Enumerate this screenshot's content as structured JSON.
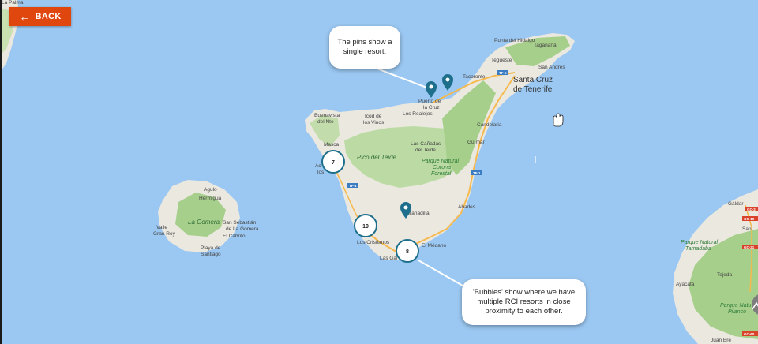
{
  "nav": {
    "back_label": "BACK",
    "back_icon": "arrow-left-icon"
  },
  "callouts": {
    "pins": "The pins show a single resort.",
    "bubbles": "'Bubbles' show where we have multiple RCI resorts in close proximity to each other."
  },
  "clusters": [
    {
      "id": "cluster-west",
      "count": "7"
    },
    {
      "id": "cluster-south",
      "count": "19"
    },
    {
      "id": "cluster-lasgalletas",
      "count": "8"
    }
  ],
  "pins": [
    {
      "id": "pin-puerto-1"
    },
    {
      "id": "pin-puerto-2"
    },
    {
      "id": "pin-granadilla"
    }
  ],
  "places": {
    "la_palma": "La Palma",
    "punta_del_hidalgo": "Punta del Hidalgo",
    "taganana": "Taganana",
    "tegueste": "Tegueste",
    "san_andres": "San Andrés",
    "tacoronte": "Tacoronte",
    "santa_cruz_1": "Santa Cruz",
    "santa_cruz_2": "de Tenerife",
    "puerto_1": "Puerto de",
    "puerto_2": "la Cruz",
    "los_realejos": "Los Realejos",
    "buenavista_1": "Buenavista",
    "buenavista_2": "del Nte",
    "icod_1": "Icod de",
    "icod_2": "los Vinos",
    "candelaria": "Candelaria",
    "masca": "Masca",
    "las_canadas_1": "Las Cañadas",
    "las_canadas_2": "del Teide",
    "guimar": "Güímar",
    "pico_del_teide": "Pico del Teide",
    "parque_1": "Parque Natural",
    "parque_2": "Corona",
    "parque_3": "Forestal",
    "acantilado_1": "Ac",
    "acantilado_2": "los",
    "agulo": "Agulo",
    "hermigua": "Hermigua",
    "la_gomera": "La Gomera",
    "san_sebastian_1": "San Sebastián",
    "san_sebastian_2": "de La Gomera",
    "valle_1": "Valle",
    "valle_2": "Gran Rey",
    "el_cabrito": "El Cabrito",
    "playa_1": "Playa de",
    "playa_2": "Santiago",
    "granadilla": "Granadilla",
    "abades": "Abades",
    "los_cristianos": "Los Cristianos",
    "el_medano": "El Médano",
    "las_galletas": "Las Gal",
    "cristianos_short": "C",
    "galdar": "Gáldar",
    "gc_parque_1": "Parque Natural",
    "gc_parque_2": "Tamadaba",
    "gc_parque_3": "Parque Natu",
    "gc_parque_4": "Pilanco",
    "gc_san": "San",
    "gc_tejeda": "Tejeda",
    "gc_ayacata": "Ayacata",
    "gc_bottom": "Juan Bre"
  },
  "roads": {
    "tf5": "TF-5",
    "tf1": "TF-1",
    "tf1b": "TF-1",
    "gc2": "GC-2",
    "gc10": "GC-10",
    "gc21": "GC-21",
    "gc60": "GC-60"
  },
  "colors": {
    "water": "#9bc8f2",
    "land": "#ebe8e0",
    "park": "#bcdba4",
    "forest": "#a6cf8b",
    "road": "#f6b94e",
    "marker": "#1d6f8c",
    "back_button": "#e0470f"
  }
}
